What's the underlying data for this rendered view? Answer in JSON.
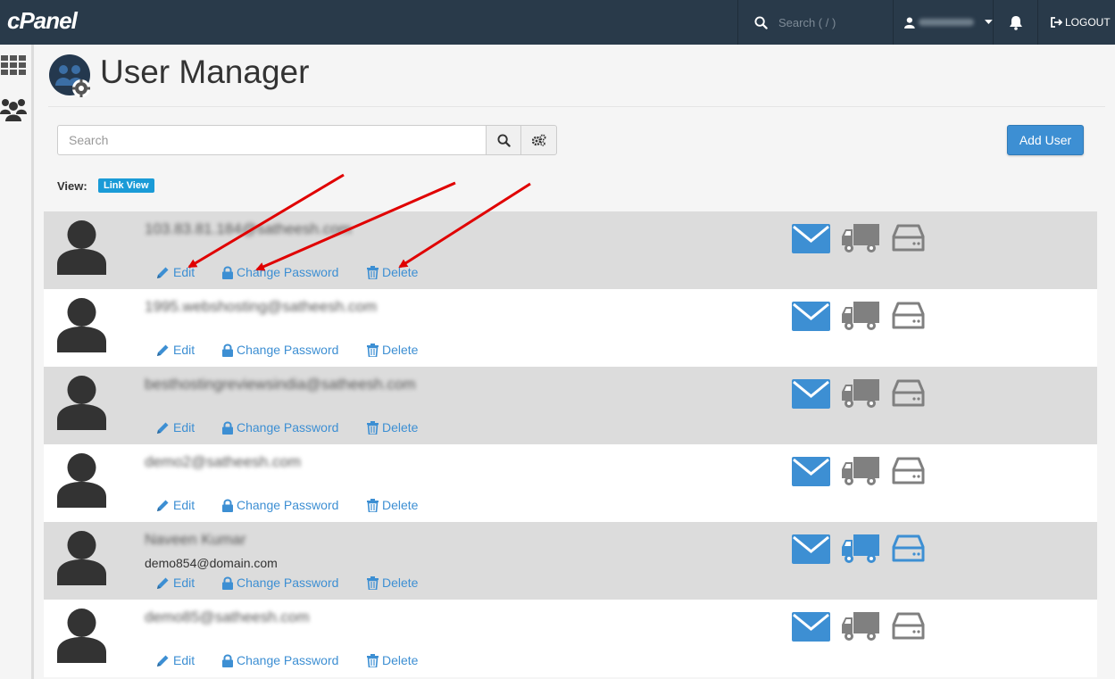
{
  "topbar": {
    "logo": "cPanel",
    "search_placeholder": "Search ( / )",
    "logout_label": "LOGOUT"
  },
  "header": {
    "title": "User Manager"
  },
  "toolbar": {
    "search_placeholder": "Search",
    "add_user_label": "Add User"
  },
  "view": {
    "label": "View:",
    "mode": "Link View"
  },
  "actions": {
    "edit": "Edit",
    "change_password": "Change Password",
    "delete": "Delete"
  },
  "users": [
    {
      "name": "103.83.81.184@satheesh.com",
      "sub": "",
      "services_active": [
        true,
        false,
        false
      ]
    },
    {
      "name": "1995.webshosting@satheesh.com",
      "sub": "",
      "services_active": [
        true,
        false,
        false
      ]
    },
    {
      "name": "besthostingreviewsindia@satheesh.com",
      "sub": "",
      "services_active": [
        true,
        false,
        false
      ]
    },
    {
      "name": "demo2@satheesh.com",
      "sub": "",
      "services_active": [
        true,
        false,
        false
      ]
    },
    {
      "name": "Naveen Kumar",
      "sub": "demo854@domain.com",
      "services_active": [
        true,
        true,
        true
      ]
    },
    {
      "name": "demo85@satheesh.com",
      "sub": "",
      "services_active": [
        true,
        false,
        false
      ]
    }
  ],
  "colors": {
    "topbar": "#293a4a",
    "accent": "#3d8fd3",
    "inactive_service": "#808080",
    "annotation_arrow": "#e00000"
  },
  "icons": [
    "search-icon",
    "user-icon",
    "bell-icon",
    "logout-icon",
    "grid-icon",
    "users-icon",
    "gears-icon",
    "pencil-icon",
    "lock-icon",
    "trash-icon",
    "envelope-icon",
    "truck-icon",
    "drive-icon"
  ]
}
